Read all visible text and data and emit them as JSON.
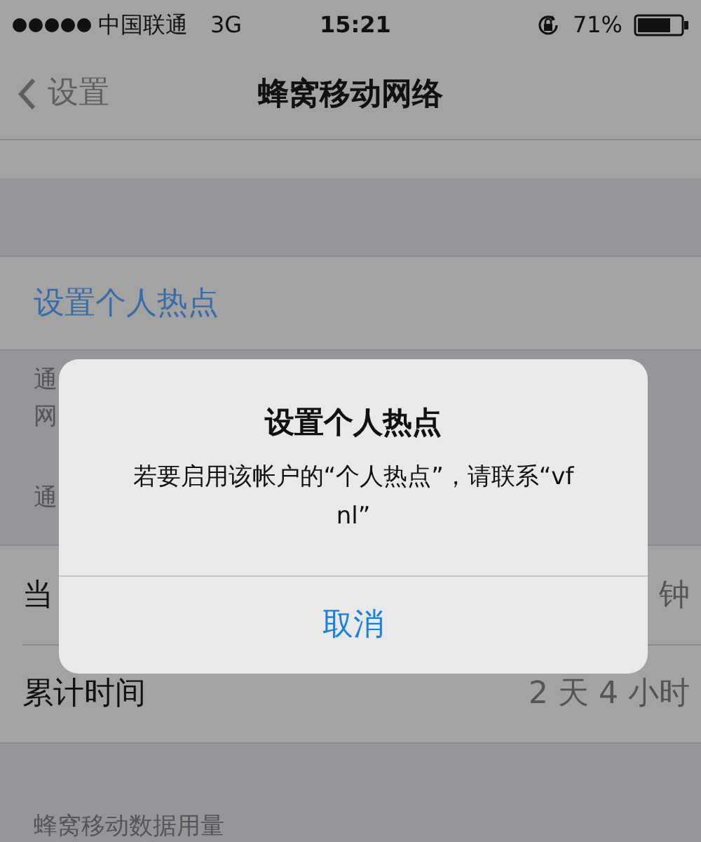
{
  "status_bar": {
    "carrier": "中国联通",
    "network": "3G",
    "time": "15:21",
    "battery": "71%"
  },
  "nav_bar": {
    "back": "设置",
    "title": "蜂窝移动网络"
  },
  "hotspot_link": "设置个人热点",
  "footer_lines": [
    "通",
    "网"
  ],
  "section_header": "通",
  "rows": [
    {
      "label": "当",
      "value": "钟"
    },
    {
      "label": "累计时间",
      "value": "2 天 4 小时"
    }
  ],
  "next_header": "蜂窝移动数据用量",
  "alert": {
    "title": "设置个人热点",
    "message": "若要启用该帐户的“个人热点”，请联系“vf nl”",
    "button": "取消"
  }
}
